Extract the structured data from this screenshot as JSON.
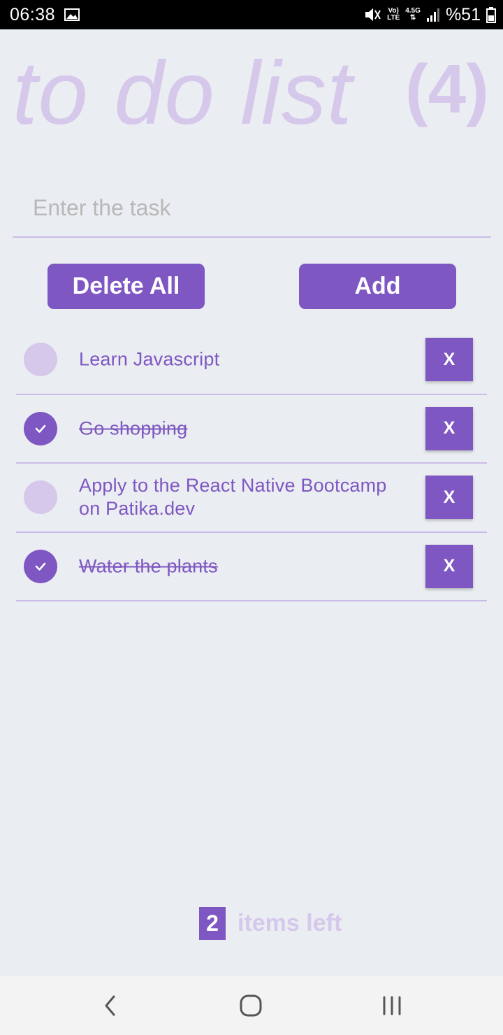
{
  "status_bar": {
    "time": "06:38",
    "network_top": "Vo)",
    "network_bottom": "LTE",
    "speed_top": "4.5G",
    "battery": "%51"
  },
  "header": {
    "title": "to do list",
    "count": "(4)"
  },
  "input": {
    "placeholder": "Enter the task",
    "value": ""
  },
  "actions": {
    "delete_all": "Delete All",
    "add": "Add"
  },
  "tasks": [
    {
      "text": "Learn Javascript",
      "done": false,
      "delete_label": "X"
    },
    {
      "text": "Go shopping",
      "done": true,
      "delete_label": "X"
    },
    {
      "text": "Apply to the React Native Bootcamp on Patika.dev",
      "done": false,
      "delete_label": "X"
    },
    {
      "text": "Water the plants",
      "done": true,
      "delete_label": "X"
    }
  ],
  "footer": {
    "count": "2",
    "label": "items left"
  },
  "colors": {
    "accent": "#7e57c2",
    "accent_light": "#d5c8eb",
    "background": "#eaedf1"
  },
  "icons": {
    "nav": [
      "back-icon",
      "home-icon",
      "recent-apps-icon"
    ]
  }
}
